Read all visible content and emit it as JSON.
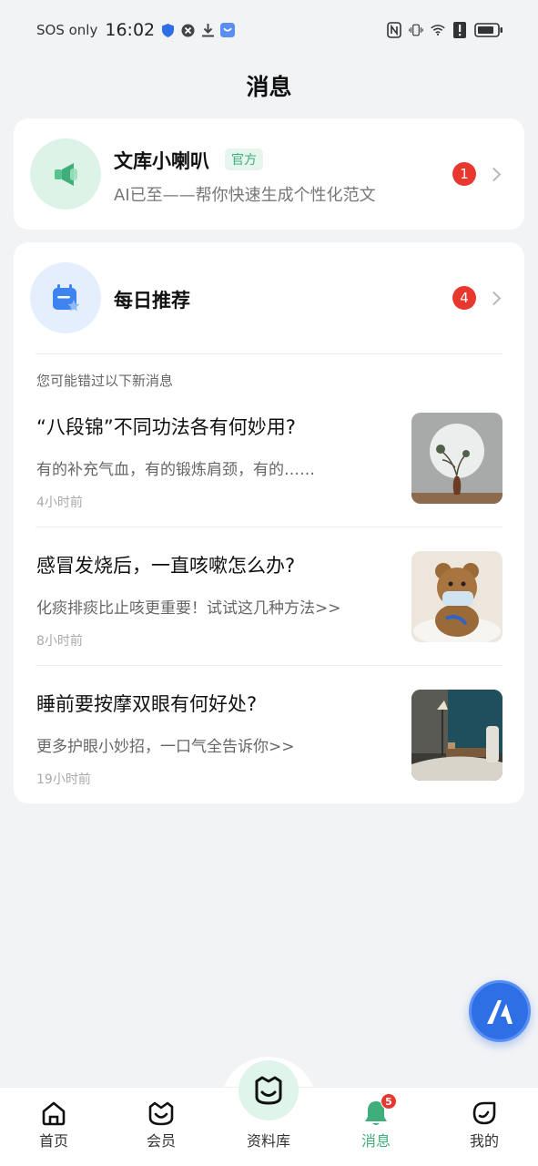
{
  "status_bar": {
    "carrier": "SOS only",
    "time": "16:02"
  },
  "page": {
    "title": "消息"
  },
  "official": {
    "title": "文库小喇叭",
    "tag": "官方",
    "subtitle": "AI已至——帮你快速生成个性化范文",
    "badge": "1",
    "icon": "megaphone-icon"
  },
  "daily": {
    "title": "每日推荐",
    "badge": "4",
    "icon": "calendar-star-icon",
    "hint": "您可能错过以下新消息",
    "items": [
      {
        "title": "“八段锦”不同功法各有何妙用?",
        "summary": "有的补充气血，有的锻炼肩颈，有的……",
        "time": "4小时前",
        "thumb": "vase-plant-image"
      },
      {
        "title": "感冒发烧后，一直咳嗽怎么办?",
        "summary": "化痰排痰比止咳更重要！试试这几种方法>>",
        "time": "8小时前",
        "thumb": "teddy-bear-mask-image"
      },
      {
        "title": "睡前要按摩双眼有何好处?",
        "summary": "更多护眼小妙招，一口气全告诉你>>",
        "time": "19小时前",
        "thumb": "bedroom-lamp-image"
      }
    ]
  },
  "bottom_nav": {
    "items": [
      {
        "label": "首页",
        "icon": "home-icon"
      },
      {
        "label": "会员",
        "icon": "vip-icon"
      },
      {
        "label": "资料库",
        "icon": "library-icon"
      },
      {
        "label": "消息",
        "icon": "bell-icon",
        "badge": "5"
      },
      {
        "label": "我的",
        "icon": "profile-icon"
      }
    ]
  },
  "colors": {
    "accent": "#3fae7a",
    "badge": "#e8372e",
    "fab": "#2f6fe6",
    "background": "#f2f3f5"
  }
}
